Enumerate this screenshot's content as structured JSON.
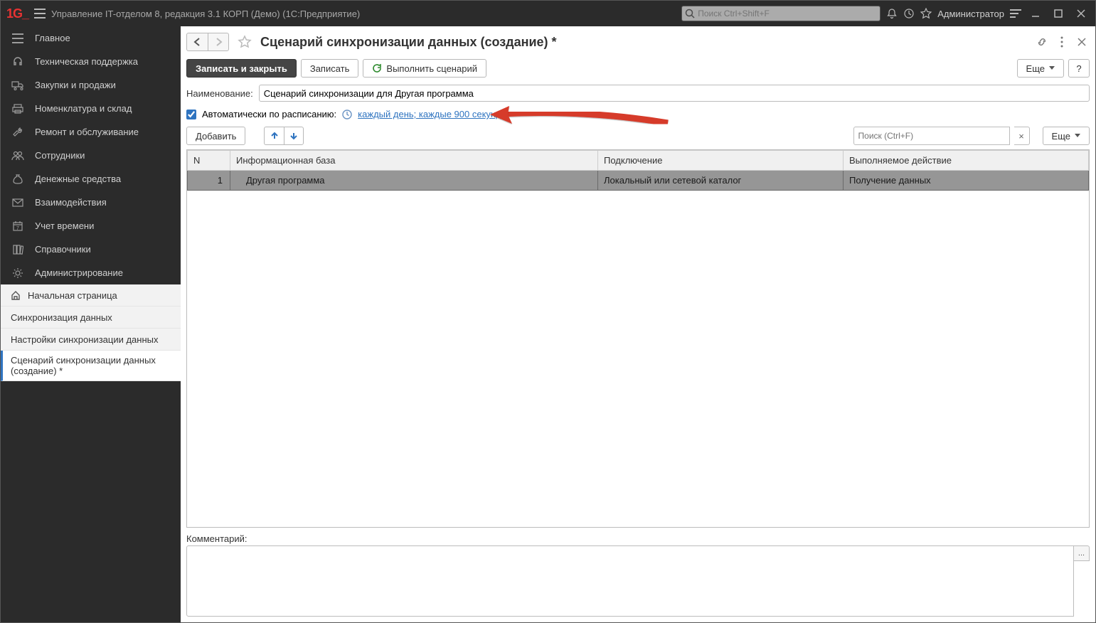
{
  "titlebar": {
    "app_title": "Управление IT-отделом 8, редакция 3.1 КОРП (Демо)  (1С:Предприятие)",
    "search_placeholder": "Поиск Ctrl+Shift+F",
    "user": "Администратор",
    "logo_text": "1G_"
  },
  "sidebar": {
    "items": [
      {
        "label": "Главное"
      },
      {
        "label": "Техническая поддержка"
      },
      {
        "label": "Закупки и продажи"
      },
      {
        "label": "Номенклатура и склад"
      },
      {
        "label": "Ремонт и обслуживание"
      },
      {
        "label": "Сотрудники"
      },
      {
        "label": "Денежные средства"
      },
      {
        "label": "Взаимодействия"
      },
      {
        "label": "Учет времени"
      },
      {
        "label": "Справочники"
      },
      {
        "label": "Администрирование"
      }
    ],
    "nav": [
      {
        "label": "Начальная страница"
      },
      {
        "label": "Синхронизация данных"
      },
      {
        "label": "Настройки синхронизации данных"
      },
      {
        "label": "Сценарий синхронизации данных (создание) *"
      }
    ]
  },
  "page": {
    "title": "Сценарий синхронизации данных (создание) *"
  },
  "toolbar": {
    "save_close": "Записать и закрыть",
    "save": "Записать",
    "run": "Выполнить сценарий",
    "more": "Еще",
    "help": "?"
  },
  "form": {
    "name_label": "Наименование:",
    "name_value": "Сценарий синхронизации для Другая программа",
    "auto_label": "Автоматически по расписанию:",
    "schedule_link": "каждый день; каждые 900 секунд",
    "auto_checked": true
  },
  "subtoolbar": {
    "add": "Добавить",
    "search_placeholder": "Поиск (Ctrl+F)",
    "clear": "×",
    "more": "Еще"
  },
  "table": {
    "headers": {
      "n": "N",
      "infobase": "Информационная база",
      "connection": "Подключение",
      "action": "Выполняемое действие"
    },
    "rows": [
      {
        "n": "1",
        "infobase": "Другая программа",
        "connection": "Локальный или сетевой каталог",
        "action": "Получение данных"
      }
    ]
  },
  "comment": {
    "label": "Комментарий:",
    "value": ""
  }
}
